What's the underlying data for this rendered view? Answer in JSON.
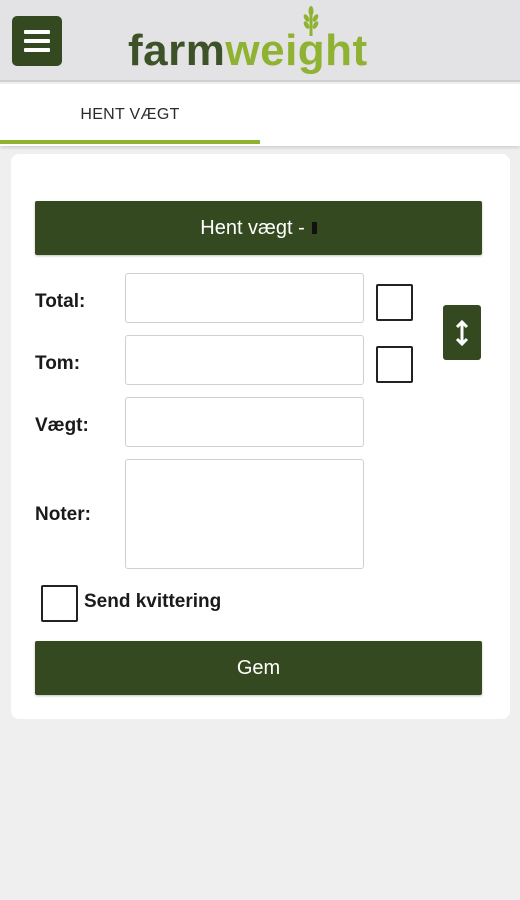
{
  "appbar": {
    "logo_part1": "farm",
    "logo_part2": "weight",
    "menu_icon": "hamburger-menu-icon"
  },
  "tabs": [
    {
      "label": "HENT VÆGT",
      "active": true
    }
  ],
  "form": {
    "fetch_button_label": "Hent vægt -",
    "total_label": "Total:",
    "total_value": "",
    "tom_label": "Tom:",
    "tom_value": "",
    "vaegt_label": "Vægt:",
    "vaegt_value": "",
    "noter_label": "Noter:",
    "noter_value": "",
    "send_receipt_label": "Send kvittering",
    "send_receipt_checked": false,
    "total_checked": false,
    "tom_checked": false,
    "swap_icon": "swap-vertical-icon",
    "save_button_label": "Gem"
  },
  "colors": {
    "primary_dark_green": "#34491f",
    "accent_green": "#8fb233",
    "logo_dark": "#3d5226",
    "appbar_bg": "#e3e3e5",
    "page_bg": "#efefef"
  }
}
